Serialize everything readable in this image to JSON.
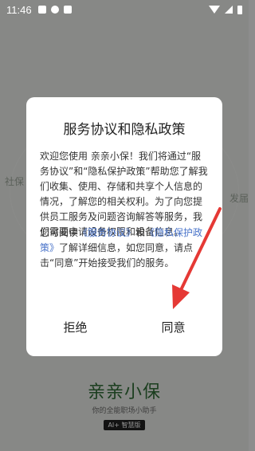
{
  "status_bar": {
    "time": "11:46"
  },
  "background": {
    "left_label": "社保",
    "right_label": "发届",
    "brand_title": "亲亲小保",
    "brand_subtitle": "你的全能职场小助手",
    "brand_badge": "AI+ 智慧版"
  },
  "dialog": {
    "title": "服务协议和隐私政策",
    "body": "欢迎您使用 亲亲小保！我们将通过“服务协议”和“隐私保护政策”帮助您了解我们收集、使用、存储和共享个人信息的情况，了解您的相关权利。为了向您提供员工服务及问题咨询解答等服务，我们需要申请设备权限和设备信息。",
    "consent_prefix": "您可阅读",
    "service_link": "《服务协议》",
    "consent_and": "和",
    "privacy_link": "《隐私保护政策》",
    "consent_suffix": "了解详细信息，如您同意，请点击“同意”开始接受我们的服务。",
    "reject_label": "拒绝",
    "agree_label": "同意"
  },
  "colors": {
    "link": "#4a74c9",
    "arrow": "#e53935",
    "brand": "#2f6b36"
  }
}
